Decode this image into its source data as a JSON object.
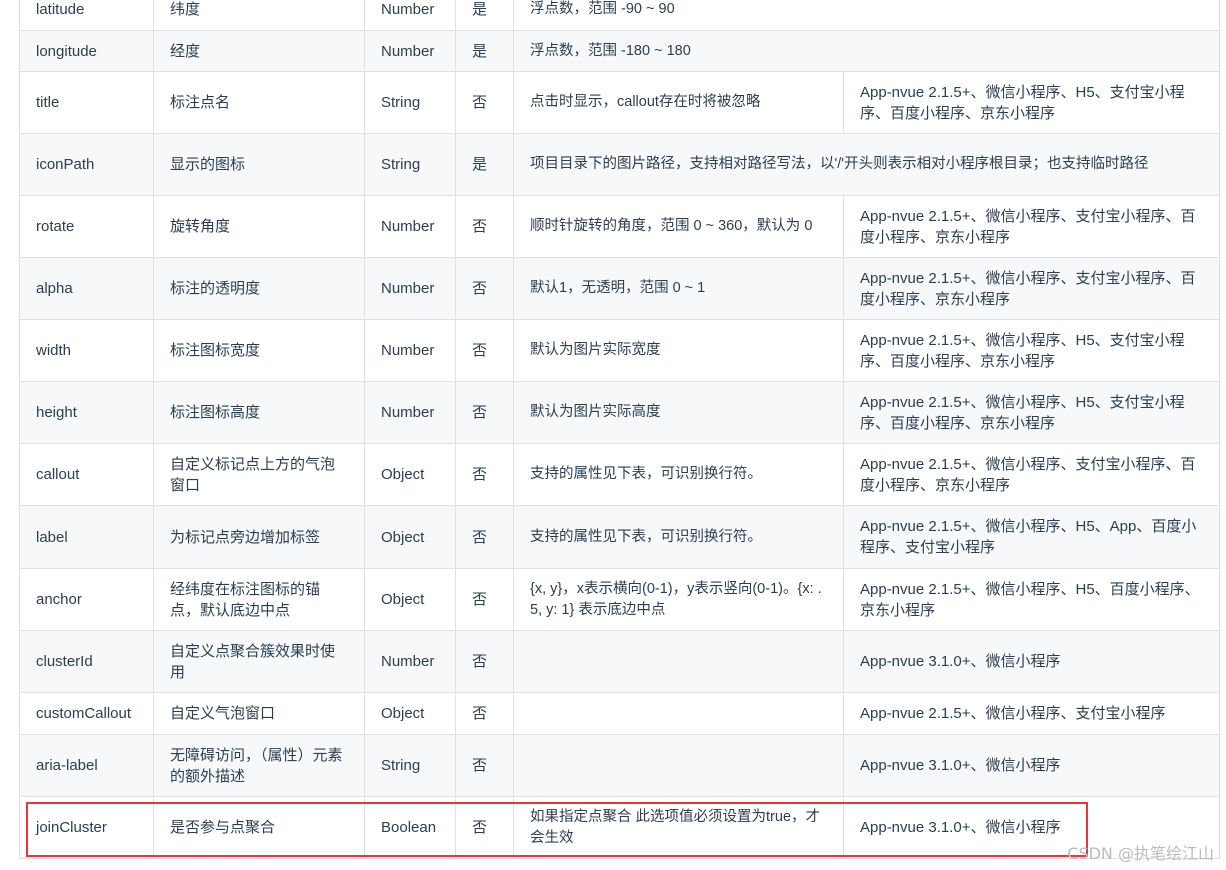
{
  "rows": [
    {
      "name": "latitude",
      "desc": "纬度",
      "type": "Number",
      "required": "是",
      "note": "浮点数，范围 -90 ~ 90",
      "platform": ""
    },
    {
      "name": "longitude",
      "desc": "经度",
      "type": "Number",
      "required": "是",
      "note": "浮点数，范围 -180 ~ 180",
      "platform": ""
    },
    {
      "name": "title",
      "desc": "标注点名",
      "type": "String",
      "required": "否",
      "note": "点击时显示，callout存在时将被忽略",
      "platform": "App-nvue 2.1.5+、微信小程序、H5、支付宝小程序、百度小程序、京东小程序"
    },
    {
      "name": "iconPath",
      "desc": "显示的图标",
      "type": "String",
      "required": "是",
      "note": "项目目录下的图片路径，支持相对路径写法，以'/'开头则表示相对小程序根目录；也支持临时路径",
      "platform": ""
    },
    {
      "name": "rotate",
      "desc": "旋转角度",
      "type": "Number",
      "required": "否",
      "note": "顺时针旋转的角度，范围 0 ~ 360，默认为 0",
      "platform": "App-nvue 2.1.5+、微信小程序、支付宝小程序、百度小程序、京东小程序"
    },
    {
      "name": "alpha",
      "desc": "标注的透明度",
      "type": "Number",
      "required": "否",
      "note": "默认1，无透明，范围 0 ~ 1",
      "platform": "App-nvue 2.1.5+、微信小程序、支付宝小程序、百度小程序、京东小程序"
    },
    {
      "name": "width",
      "desc": "标注图标宽度",
      "type": "Number",
      "required": "否",
      "note": "默认为图片实际宽度",
      "platform": "App-nvue 2.1.5+、微信小程序、H5、支付宝小程序、百度小程序、京东小程序"
    },
    {
      "name": "height",
      "desc": "标注图标高度",
      "type": "Number",
      "required": "否",
      "note": "默认为图片实际高度",
      "platform": "App-nvue 2.1.5+、微信小程序、H5、支付宝小程序、百度小程序、京东小程序"
    },
    {
      "name": "callout",
      "desc": "自定义标记点上方的气泡窗口",
      "type": "Object",
      "required": "否",
      "note": "支持的属性见下表，可识别换行符。",
      "platform": "App-nvue 2.1.5+、微信小程序、支付宝小程序、百度小程序、京东小程序"
    },
    {
      "name": "label",
      "desc": "为标记点旁边增加标签",
      "type": "Object",
      "required": "否",
      "note": "支持的属性见下表，可识别换行符。",
      "platform": "App-nvue 2.1.5+、微信小程序、H5、App、百度小程序、支付宝小程序"
    },
    {
      "name": "anchor",
      "desc": "经纬度在标注图标的锚点，默认底边中点",
      "type": "Object",
      "required": "否",
      "note": "{x, y}，x表示横向(0-1)，y表示竖向(0-1)。{x: .5, y: 1} 表示底边中点",
      "platform": "App-nvue 2.1.5+、微信小程序、H5、百度小程序、京东小程序"
    },
    {
      "name": "clusterId",
      "desc": "自定义点聚合簇效果时使用",
      "type": "Number",
      "required": "否",
      "note": "",
      "platform": "App-nvue 3.1.0+、微信小程序"
    },
    {
      "name": "customCallout",
      "desc": "自定义气泡窗口",
      "type": "Object",
      "required": "否",
      "note": "",
      "platform": "App-nvue 2.1.5+、微信小程序、支付宝小程序"
    },
    {
      "name": "aria-label",
      "desc": "无障碍访问，（属性）元素的额外描述",
      "type": "String",
      "required": "否",
      "note": "",
      "platform": "App-nvue 3.1.0+、微信小程序"
    },
    {
      "name": "joinCluster",
      "desc": "是否参与点聚合",
      "type": "Boolean",
      "required": "否",
      "note": "如果指定点聚合 此选项值必须设置为true，才会生效",
      "platform": "App-nvue 3.1.0+、微信小程序"
    }
  ],
  "watermark": "CSDN @执笔绘江山"
}
